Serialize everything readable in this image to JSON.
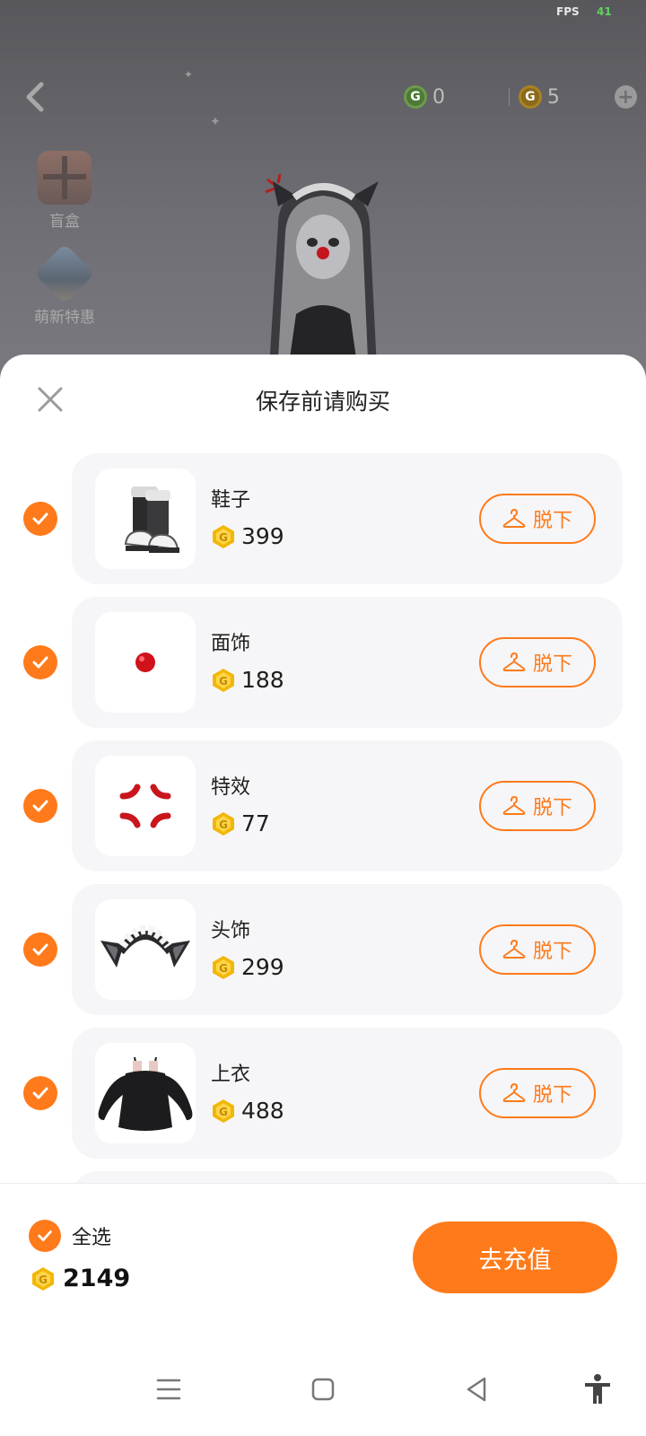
{
  "status": {
    "fps_label": "FPS",
    "fps_value": "41"
  },
  "top_bar": {
    "green_coin_count": "0",
    "gold_coin_count": "5"
  },
  "side_entries": [
    {
      "label": "盲盒",
      "icon": "gift-box-icon"
    },
    {
      "label": "萌新特惠",
      "icon": "promo-bundle-icon"
    }
  ],
  "sheet": {
    "title": "保存前请购买",
    "takeoff_label": "脱下",
    "items": [
      {
        "name": "鞋子",
        "price": "399",
        "icon": "shoes-icon",
        "checked": true
      },
      {
        "name": "面饰",
        "price": "188",
        "icon": "red-nose-icon",
        "checked": true
      },
      {
        "name": "特效",
        "price": "77",
        "icon": "anger-effect-icon",
        "checked": true
      },
      {
        "name": "头饰",
        "price": "299",
        "icon": "maid-headband-icon",
        "checked": true
      },
      {
        "name": "上衣",
        "price": "488",
        "icon": "black-dress-icon",
        "checked": true
      }
    ]
  },
  "footer": {
    "select_all_label": "全选",
    "total": "2149",
    "recharge_label": "去充值"
  },
  "colors": {
    "accent": "#ff7a1a",
    "coin_gold": "#f2b705"
  }
}
